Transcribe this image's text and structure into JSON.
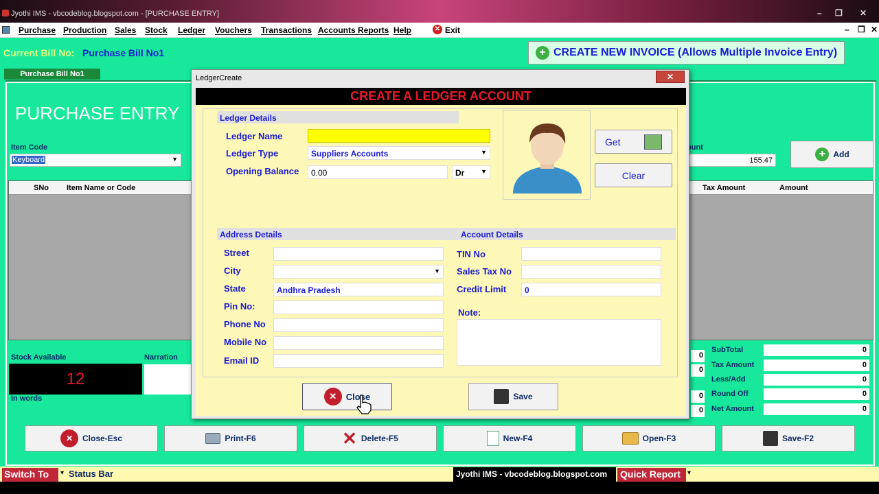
{
  "window": {
    "title": "Jyothi IMS - vbcodeblog.blogspot.com - [PURCHASE ENTRY]"
  },
  "menu": {
    "items": [
      "Purchase",
      "Production",
      "Sales",
      "Stock",
      "Ledger",
      "Vouchers",
      "Transactions",
      "Accounts Reports",
      "Help",
      "Exit"
    ]
  },
  "bill": {
    "label": "Current Bill No:",
    "value": "Purchase Bill No1",
    "tab": "Purchase Bill No1"
  },
  "create_invoice_label": "CREATE NEW INVOICE (Allows Multiple Invoice Entry)",
  "page_title": "PURCHASE ENTRY",
  "item": {
    "code_label": "Item Code",
    "code_value": "Keyboard",
    "amount_label": "ount",
    "amount_value": "155.47",
    "add_label": "Add"
  },
  "grid": {
    "columns": [
      "SNo",
      "Item Name or Code",
      "Tax Amount",
      "Amount"
    ]
  },
  "stock": {
    "label": "Stock Available",
    "value": "12",
    "narration_label": "Narration",
    "in_words_label": "In words"
  },
  "totals": {
    "labels": [
      "SubTotal",
      "Tax Amount",
      "Less/Add",
      "Round Off",
      "Net Amount"
    ],
    "values": [
      "0",
      "0",
      "0",
      "0",
      "0"
    ],
    "small_values": [
      "0",
      "0",
      "0",
      "0"
    ]
  },
  "toolbar": [
    "Close-Esc",
    "Print-F6",
    "Delete-F5",
    "New-F4",
    "Open-F3",
    "Save-F2"
  ],
  "statusbar": {
    "switch_to": "Switch To",
    "status": "Status Bar",
    "app": "Jyothi IMS - vbcodeblog.blogspot.com",
    "quick_report": "Quick Report"
  },
  "dialog": {
    "title": "LedgerCreate",
    "heading": "CREATE A LEDGER ACCOUNT",
    "ledger_section": "Ledger Details",
    "ledger_name_label": "Ledger Name",
    "ledger_name_value": "",
    "ledger_type_label": "Ledger Type",
    "ledger_type_value": "Suppliers Accounts",
    "opening_balance_label": "Opening Balance",
    "opening_balance_value": "0.00",
    "drcr_value": "Dr",
    "get_label": "Get",
    "clear_label": "Clear",
    "address_section": "Address Details",
    "account_section": "Account Details",
    "street_label": "Street",
    "city_label": "City",
    "state_label": "State",
    "state_value": "Andhra Pradesh",
    "pin_label": "Pin No:",
    "phone_label": "Phone No",
    "mobile_label": "Mobile No",
    "email_label": "Email ID",
    "tin_label": "TIN No",
    "salestax_label": "Sales Tax No",
    "credit_label": "Credit Limit",
    "credit_value": "0",
    "note_label": "Note:",
    "close_label": "Close",
    "save_label": "Save"
  },
  "colors": {
    "main_bg": "#17e89b",
    "dialog_bg": "#fdf8b8",
    "heading_red": "#e8182a",
    "label_blue": "#1a1ad6"
  }
}
